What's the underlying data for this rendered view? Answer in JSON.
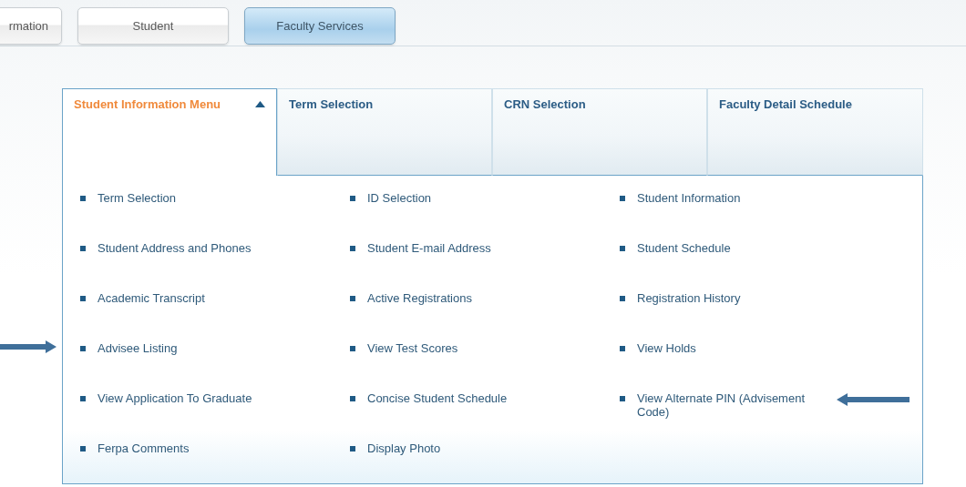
{
  "top_tabs": [
    {
      "label": "rmation",
      "selected": false
    },
    {
      "label": "Student",
      "selected": false
    },
    {
      "label": "Faculty Services",
      "selected": true
    }
  ],
  "menu_tabs": [
    {
      "label": "Student Information Menu",
      "selected": true
    },
    {
      "label": "Term Selection",
      "selected": false
    },
    {
      "label": "CRN Selection",
      "selected": false
    },
    {
      "label": "Faculty Detail Schedule",
      "selected": false
    }
  ],
  "items": [
    {
      "label": "Term Selection",
      "kind": "plain"
    },
    {
      "label": "ID Selection",
      "kind": "plain"
    },
    {
      "label": "Student Information",
      "kind": "plain"
    },
    {
      "label": "Student Address and Phones",
      "kind": "plain"
    },
    {
      "label": "Student E-mail Address",
      "kind": "plain"
    },
    {
      "label": "Student Schedule",
      "kind": "plain"
    },
    {
      "label": "Academic Transcript",
      "kind": "plain"
    },
    {
      "label": "Active Registrations",
      "kind": "plain"
    },
    {
      "label": "Registration History",
      "kind": "plain"
    },
    {
      "label": "Advisee Listing",
      "kind": "arrowleft"
    },
    {
      "label": "View Test Scores",
      "kind": "plain"
    },
    {
      "label": "View Holds",
      "kind": "plain"
    },
    {
      "label": "View Application To Graduate",
      "kind": "plain"
    },
    {
      "label": "Concise Student Schedule",
      "kind": "plain"
    },
    {
      "label": "View Alternate PIN (Advisement Code)",
      "kind": "arrowright"
    },
    {
      "label": "Ferpa Comments",
      "kind": "plain"
    },
    {
      "label": "Display Photo",
      "kind": "plain"
    }
  ]
}
